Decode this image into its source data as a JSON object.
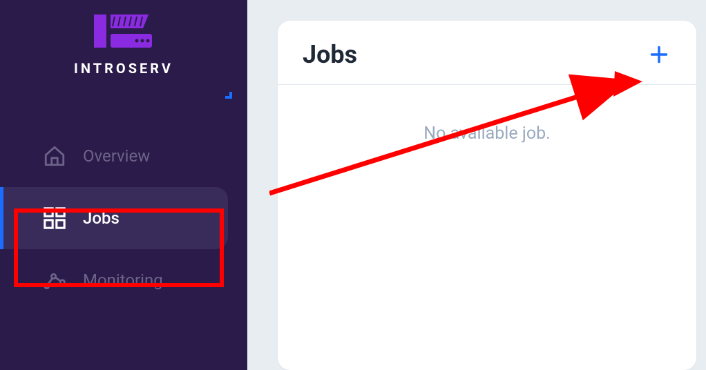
{
  "brand": {
    "name": "INTROSERV"
  },
  "sidebar": {
    "items": [
      {
        "label": "Overview",
        "active": false
      },
      {
        "label": "Jobs",
        "active": true
      },
      {
        "label": "Monitoring",
        "active": false
      }
    ]
  },
  "main": {
    "card_title": "Jobs",
    "empty_message": "No available job."
  },
  "colors": {
    "sidebar_bg": "#2a1b4a",
    "active_bg": "#3a2c5a",
    "accent_blue": "#1a6dff",
    "logo_purple": "#8a2be2",
    "annotation_red": "#ff0000",
    "muted_text": "#6d6388"
  }
}
